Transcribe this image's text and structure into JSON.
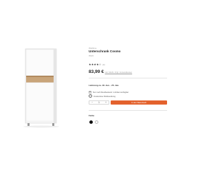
{
  "product": {
    "brand": "Welltime",
    "title": "Unterschrank Cosmo",
    "subtitle": "Weiß",
    "rating_stars": [
      "★",
      "★",
      "★",
      "★",
      "☆"
    ],
    "rating_count": "(0)",
    "price": "83,99 €",
    "price_info": "inkl. MwSt. Zzgl. Versandkosten"
  },
  "delivery": {
    "label": "Lieferung ca. 18. Jan. - 25. Jan.",
    "stock_text": "Nur noch Restbestand: 1 Artikel verfügbar",
    "info_text": "Kostenlose Rücksendung"
  },
  "purchase": {
    "qty_minus": "−",
    "qty_value": "1",
    "qty_plus": "+",
    "cart_label": "In den Warenkorb"
  },
  "colors": {
    "label": "Farbe",
    "options": [
      "black",
      "white"
    ]
  },
  "theme": {
    "accent": "#e3622d"
  }
}
